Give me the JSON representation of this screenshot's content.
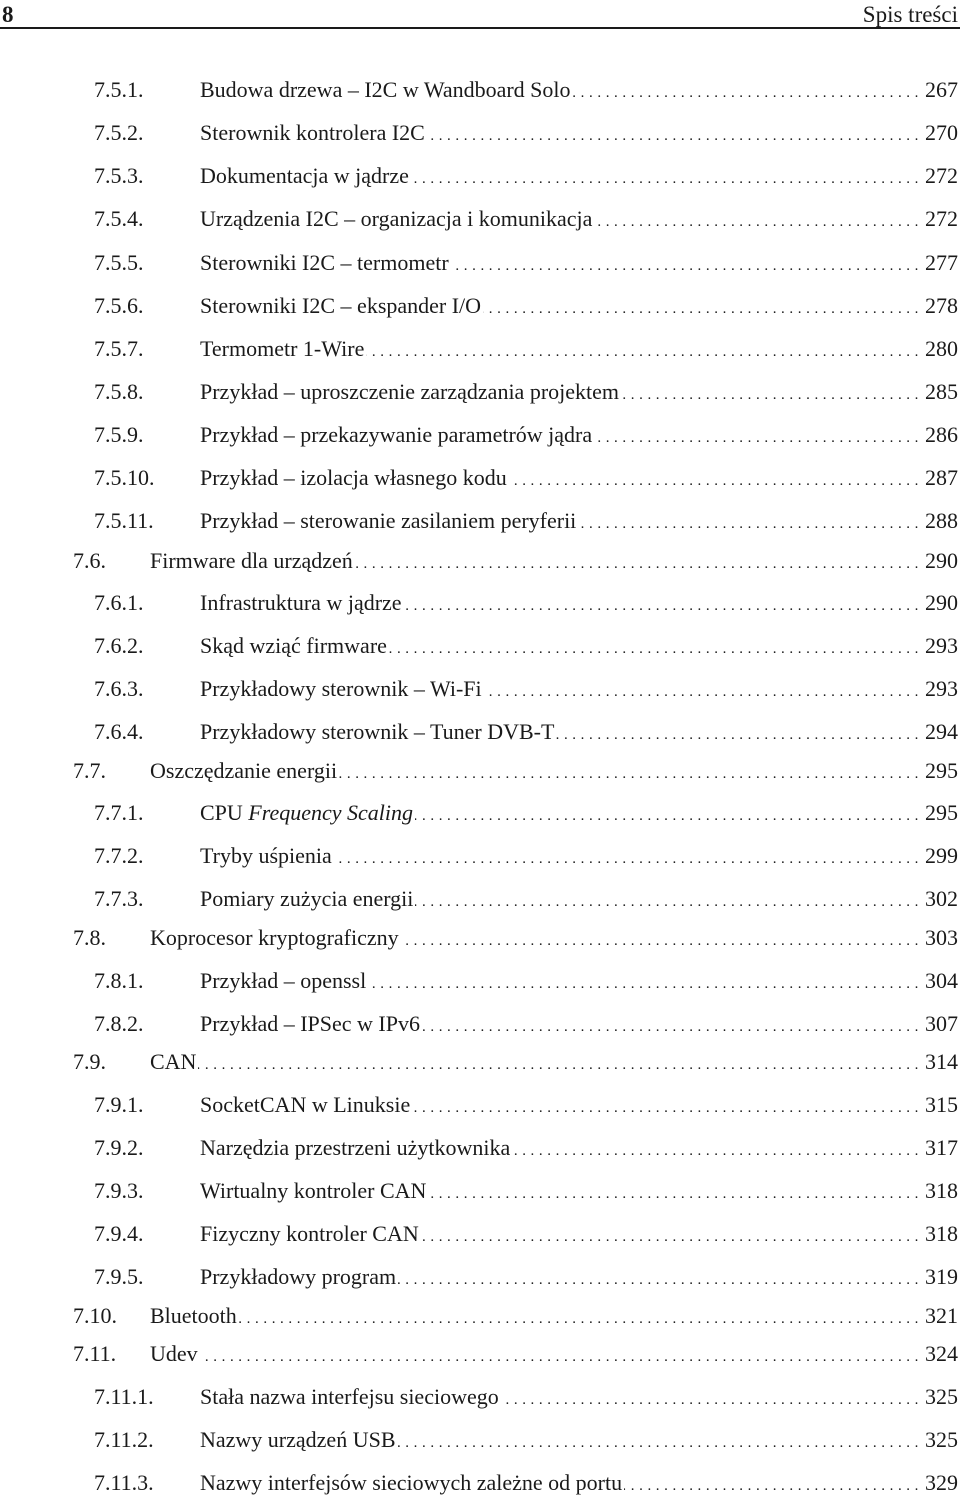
{
  "header": {
    "page_number": "8",
    "running_title": "Spis treści"
  },
  "toc": [
    {
      "level": 3,
      "number": "7.5.1.",
      "title": "Budowa drzewa – I2C w Wandboard Solo",
      "page": "267"
    },
    {
      "level": 3,
      "number": "7.5.2.",
      "title": "Sterownik kontrolera I2C",
      "page": "270"
    },
    {
      "level": 3,
      "number": "7.5.3.",
      "title": "Dokumentacja w jądrze",
      "page": "272"
    },
    {
      "level": 3,
      "number": "7.5.4.",
      "title": "Urządzenia I2C – organizacja i komunikacja",
      "page": "272"
    },
    {
      "level": 3,
      "number": "7.5.5.",
      "title": "Sterowniki I2C – termometr",
      "page": "277"
    },
    {
      "level": 3,
      "number": "7.5.6.",
      "title": "Sterowniki I2C – ekspander I/O",
      "page": "278"
    },
    {
      "level": 3,
      "number": "7.5.7.",
      "title": "Termometr 1-Wire",
      "page": "280"
    },
    {
      "level": 3,
      "number": "7.5.8.",
      "title": "Przykład – uproszczenie zarządzania projektem",
      "page": "285"
    },
    {
      "level": 3,
      "number": "7.5.9.",
      "title": "Przykład – przekazywanie parametrów jądra",
      "page": "286"
    },
    {
      "level": 3,
      "number": "7.5.10.",
      "title": "Przykład – izolacja własnego kodu",
      "page": "287"
    },
    {
      "level": 3,
      "number": "7.5.11.",
      "title": "Przykład – sterowanie zasilaniem peryferii",
      "page": "288"
    },
    {
      "level": 2,
      "number": "7.6.",
      "title": "Firmware dla urządzeń",
      "page": "290"
    },
    {
      "level": 3,
      "number": "7.6.1.",
      "title": "Infrastruktura w jądrze",
      "page": "290"
    },
    {
      "level": 3,
      "number": "7.6.2.",
      "title": "Skąd wziąć firmware",
      "page": "293"
    },
    {
      "level": 3,
      "number": "7.6.3.",
      "title": "Przykładowy sterownik – Wi-Fi",
      "page": "293"
    },
    {
      "level": 3,
      "number": "7.6.4.",
      "title": "Przykładowy sterownik – Tuner DVB-T",
      "page": "294"
    },
    {
      "level": 2,
      "number": "7.7.",
      "title": "Oszczędzanie energii",
      "page": "295"
    },
    {
      "level": 3,
      "number": "7.7.1.",
      "title": "CPU ",
      "title_italic": "Frequency Scaling",
      "page": "295"
    },
    {
      "level": 3,
      "number": "7.7.2.",
      "title": "Tryby uśpienia",
      "page": "299"
    },
    {
      "level": 3,
      "number": "7.7.3.",
      "title": "Pomiary zużycia energii",
      "page": "302"
    },
    {
      "level": 2,
      "number": "7.8.",
      "title": "Koprocesor kryptograficzny",
      "page": "303"
    },
    {
      "level": 3,
      "number": "7.8.1.",
      "title": "Przykład – openssl",
      "page": "304"
    },
    {
      "level": 3,
      "number": "7.8.2.",
      "title": "Przykład – IPSec w IPv6",
      "page": "307"
    },
    {
      "level": 2,
      "number": "7.9.",
      "title": "CAN",
      "page": "314"
    },
    {
      "level": 3,
      "number": "7.9.1.",
      "title": "SocketCAN w Linuksie",
      "page": "315"
    },
    {
      "level": 3,
      "number": "7.9.2.",
      "title": "Narzędzia przestrzeni użytkownika",
      "page": "317"
    },
    {
      "level": 3,
      "number": "7.9.3.",
      "title": "Wirtualny kontroler CAN",
      "page": "318"
    },
    {
      "level": 3,
      "number": "7.9.4.",
      "title": "Fizyczny kontroler CAN",
      "page": "318"
    },
    {
      "level": 3,
      "number": "7.9.5.",
      "title": "Przykładowy program",
      "page": "319"
    },
    {
      "level": 2,
      "number": "7.10.",
      "title": "Bluetooth",
      "page": "321"
    },
    {
      "level": 2,
      "number": "7.11.",
      "title": "Udev",
      "page": "324"
    },
    {
      "level": 3,
      "number": "7.11.1.",
      "title": "Stała nazwa interfejsu sieciowego",
      "page": "325"
    },
    {
      "level": 3,
      "number": "7.11.2.",
      "title": "Nazwy urządzeń USB",
      "page": "325"
    },
    {
      "level": 3,
      "number": "7.11.3.",
      "title": "Nazwy interfejsów sieciowych zależne od portu",
      "page": "329"
    }
  ]
}
